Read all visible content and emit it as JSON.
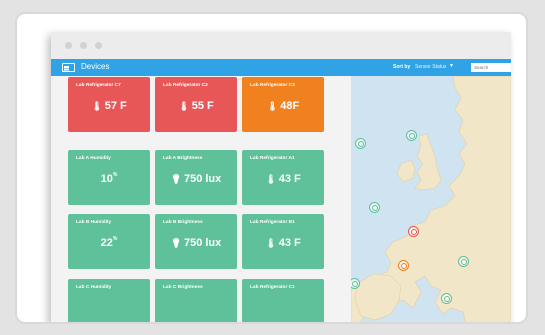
{
  "app": {
    "title": "Devices",
    "sort_label": "Sort by",
    "sort_value": "Sensor Status",
    "search_placeholder": "Search"
  },
  "colors": {
    "red": "#e85757",
    "orange": "#f1801e",
    "green": "#5fc19a",
    "accent": "#2fa3e6"
  },
  "devices": [
    {
      "label": "Lab Refrigerator C7",
      "value": "57 F",
      "icon": "thermometer-icon",
      "status": "red"
    },
    {
      "label": "Lab Refrigerator C2",
      "value": "55 F",
      "icon": "thermometer-icon",
      "status": "red"
    },
    {
      "label": "Lab Refrigerator C3",
      "value": "48F",
      "icon": "thermometer-icon",
      "status": "orange"
    },
    {
      "label": "Lab A Humidity",
      "value": "10",
      "unit": "%",
      "icon": "",
      "status": "green"
    },
    {
      "label": "Lab A Brightness",
      "value": "750 lux",
      "icon": "lightbulb-icon",
      "status": "green"
    },
    {
      "label": "Lab Refrigerator A1",
      "value": "43 F",
      "icon": "thermometer-icon",
      "status": "green"
    },
    {
      "label": "Lab B Humidity",
      "value": "22",
      "unit": "%",
      "icon": "",
      "status": "green"
    },
    {
      "label": "Lab B Brightness",
      "value": "750 lux",
      "icon": "lightbulb-icon",
      "status": "green"
    },
    {
      "label": "Lab Refrigerator B1",
      "value": "43 F",
      "icon": "thermometer-icon",
      "status": "green"
    },
    {
      "label": "Lab C Humidity",
      "value": "",
      "icon": "",
      "status": "green"
    },
    {
      "label": "Lab C Brightness",
      "value": "",
      "icon": "",
      "status": "green"
    },
    {
      "label": "Lab Refrigerator C1",
      "value": "",
      "icon": "",
      "status": "green"
    }
  ],
  "map_pins": [
    {
      "status": "green"
    },
    {
      "status": "green"
    },
    {
      "status": "green"
    },
    {
      "status": "green"
    },
    {
      "status": "green"
    },
    {
      "status": "red"
    },
    {
      "status": "orange"
    },
    {
      "status": "green"
    },
    {
      "status": "green"
    },
    {
      "status": "green"
    },
    {
      "status": "green"
    }
  ]
}
